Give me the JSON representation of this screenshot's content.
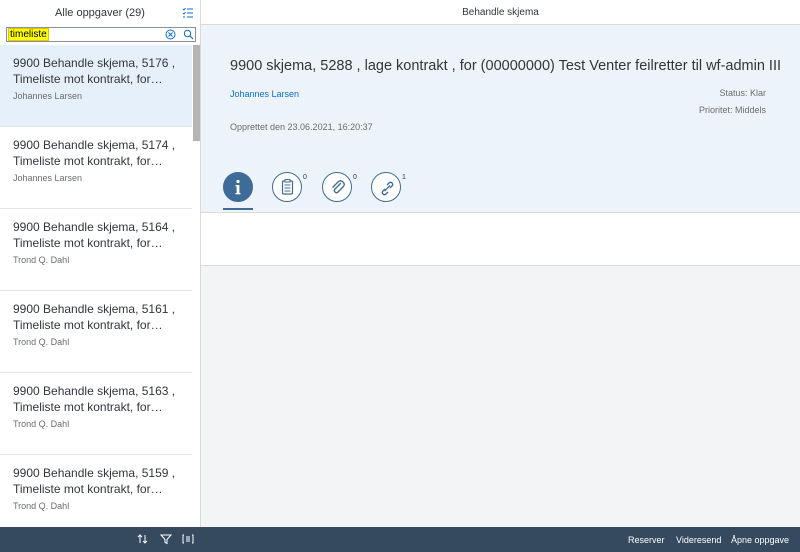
{
  "master": {
    "title": "Alle oppgaver (29)",
    "search": {
      "value": "timeliste"
    },
    "items": [
      {
        "title": "9900 Behandle skjema, 5176 , Timeliste mot kontrakt, for…",
        "person": "Johannes Larsen",
        "selected": true
      },
      {
        "title": "9900 Behandle skjema, 5174 , Timeliste mot kontrakt, for…",
        "person": "Johannes Larsen"
      },
      {
        "title": "9900 Behandle skjema, 5164 , Timeliste mot kontrakt, for…",
        "person": "Trond Q. Dahl"
      },
      {
        "title": "9900 Behandle skjema, 5161 , Timeliste mot kontrakt, for…",
        "person": "Trond Q. Dahl"
      },
      {
        "title": "9900 Behandle skjema, 5163 , Timeliste mot kontrakt, for…",
        "person": "Trond Q. Dahl"
      },
      {
        "title": "9900 Behandle skjema, 5159 , Timeliste mot kontrakt, for…",
        "person": "Trond Q. Dahl"
      }
    ]
  },
  "detail": {
    "title": "Behandle skjema",
    "header": {
      "object_title": "9900 skjema, 5288 , lage kontrakt , for (00000000) Test Venter feilretter til wf-admin III",
      "person": "Johannes Larsen",
      "status": "Status: Klar",
      "priority": "Prioritet: Middels",
      "created": "Opprettet den 23.06.2021, 16:20:37"
    },
    "tabs": [
      {
        "icon": "info-icon",
        "count": ""
      },
      {
        "icon": "notes-icon",
        "count": "0"
      },
      {
        "icon": "attachment-icon",
        "count": "0"
      },
      {
        "icon": "link-icon",
        "count": "1"
      }
    ],
    "footer": {
      "reserve": "Reserver",
      "forward": "Videresend",
      "open": "Åpne oppgave"
    }
  },
  "colors": {
    "shell_bar": "#354a5f",
    "accent": "#3e6b97",
    "link": "#0a6ed1",
    "selected_row": "#e5f0fa",
    "header_bg": "#edf3fa"
  }
}
